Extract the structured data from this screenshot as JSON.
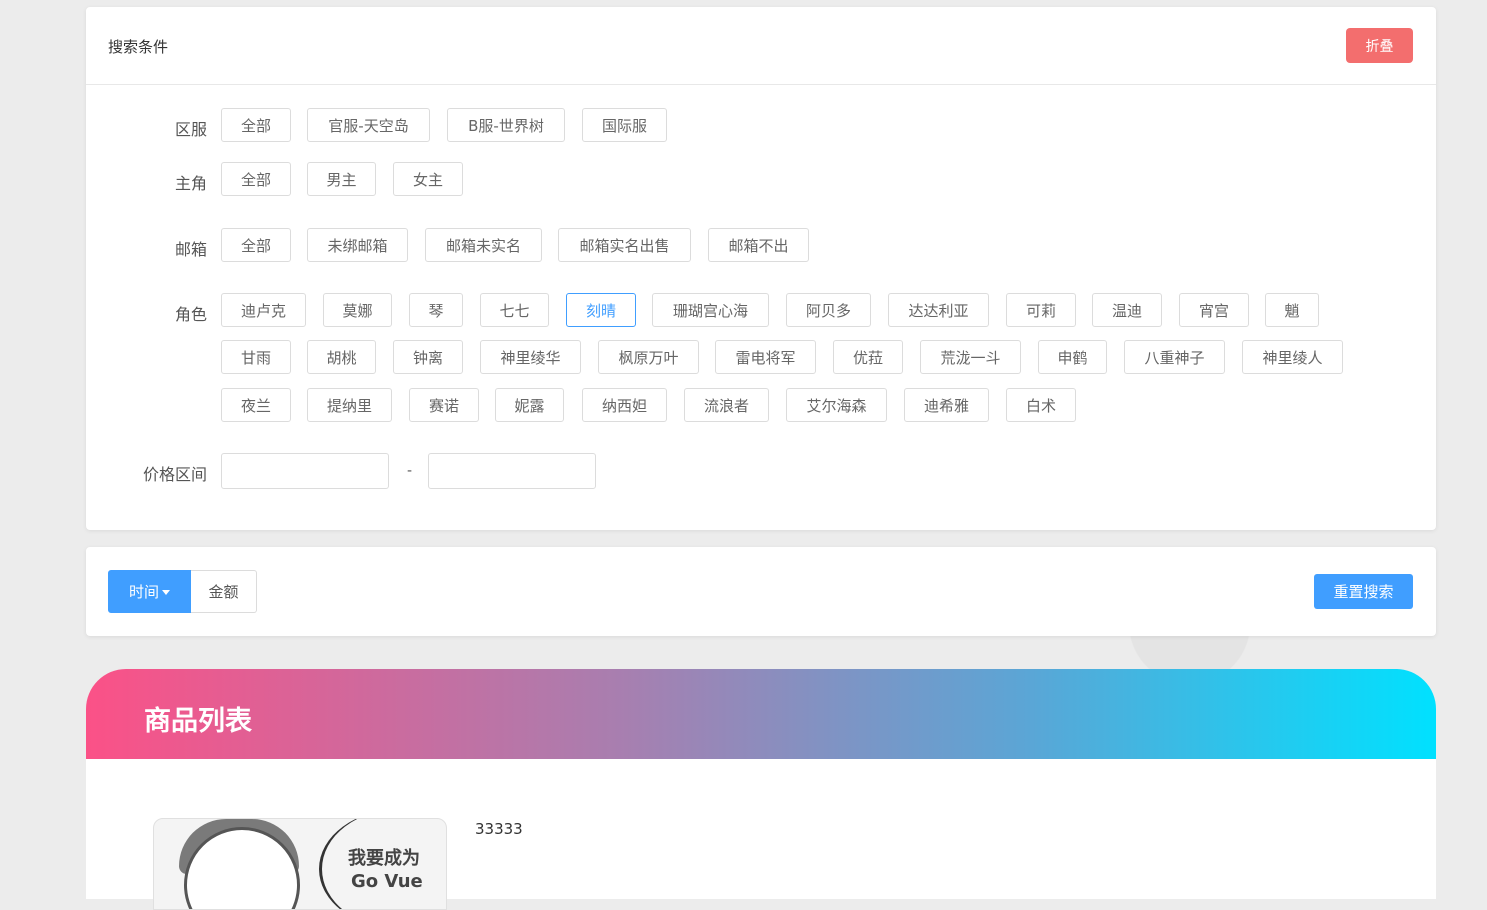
{
  "search": {
    "title": "搜索条件",
    "fold_label": "折叠",
    "region": {
      "label": "区服",
      "options": [
        "全部",
        "官服-天空岛",
        "B服-世界树",
        "国际服"
      ]
    },
    "protagonist": {
      "label": "主角",
      "options": [
        "全部",
        "男主",
        "女主"
      ]
    },
    "email": {
      "label": "邮箱",
      "options": [
        "全部",
        "未绑邮箱",
        "邮箱未实名",
        "邮箱实名出售",
        "邮箱不出"
      ]
    },
    "characters": {
      "label": "角色",
      "selected": "刻晴",
      "options": [
        "迪卢克",
        "莫娜",
        "琴",
        "七七",
        "刻晴",
        "珊瑚宫心海",
        "阿贝多",
        "达达利亚",
        "可莉",
        "温迪",
        "宵宫",
        "魈",
        "甘雨",
        "胡桃",
        "钟离",
        "神里绫华",
        "枫原万叶",
        "雷电将军",
        "优菈",
        "荒泷一斗",
        "申鹤",
        "八重神子",
        "神里绫人",
        "夜兰",
        "提纳里",
        "赛诺",
        "妮露",
        "纳西妲",
        "流浪者",
        "艾尔海森",
        "迪希雅",
        "白术"
      ]
    },
    "price": {
      "label": "价格区间",
      "separator": "-",
      "min_value": "",
      "max_value": ""
    }
  },
  "sort": {
    "time_label": "时间",
    "amount_label": "金额",
    "reset_label": "重置搜索"
  },
  "list": {
    "title": "商品列表",
    "items": [
      {
        "title": "33333",
        "image_text_line1": "我要成为",
        "image_text_line2": "Go Vue"
      }
    ]
  },
  "colors": {
    "primary": "#409eff",
    "danger": "#f36e6e",
    "gradient_start": "#fb5187",
    "gradient_end": "#00e1ff"
  }
}
